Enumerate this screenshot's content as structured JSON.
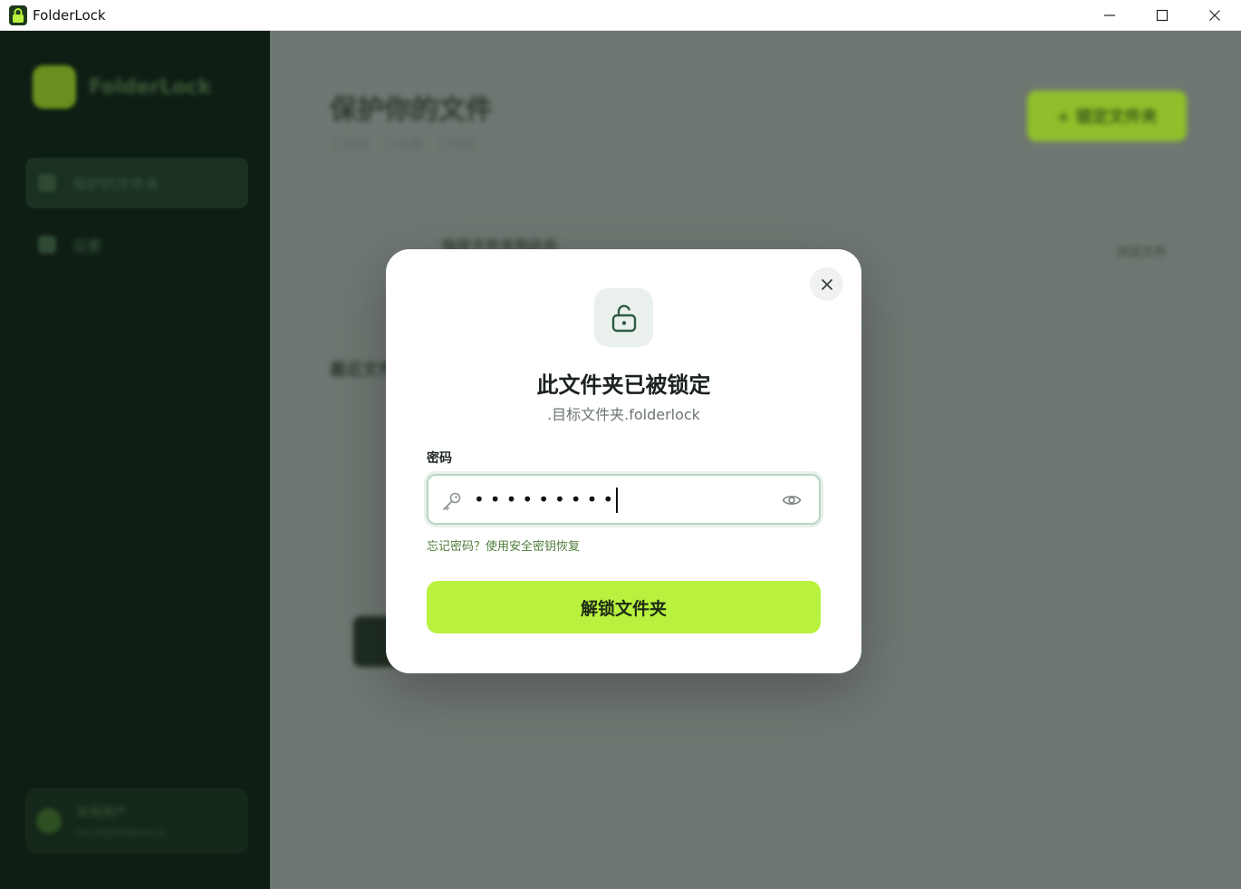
{
  "window": {
    "title": "FolderLock",
    "controls": {
      "minimize": "—",
      "maximize": "☐",
      "close": "✕"
    }
  },
  "sidebar": {
    "brand": "FolderLock",
    "items": [
      {
        "label": "保护的文件夹",
        "active": true
      },
      {
        "label": "设置",
        "active": false
      }
    ],
    "user": {
      "name": "本地用户",
      "email": "local@folderlock"
    }
  },
  "main": {
    "title": "保护你的文件",
    "subtitle": "已加密 · 已隐藏 · 已锁定",
    "primary_button": "+ 锁定文件夹",
    "strip_label": "拖放文件夹到此处",
    "strip_action": "浏览文件",
    "section_title": "最近文件夹"
  },
  "modal": {
    "title": "此文件夹已被锁定",
    "subtitle": ".目标文件夹.folderlock",
    "password_label": "密码",
    "password_value": "•••••••••",
    "forgot_link": "忘记密码？使用安全密钥恢复",
    "unlock_button": "解锁文件夹"
  },
  "colors": {
    "accent": "#b8f23f",
    "sidebar_bg": "#0f1e14",
    "overlay": "#6f7772",
    "link": "#4f7c3a"
  },
  "icons": [
    "app-lock-icon",
    "minimize-icon",
    "maximize-icon",
    "close-icon",
    "unlock-icon",
    "key-icon",
    "eye-icon"
  ]
}
